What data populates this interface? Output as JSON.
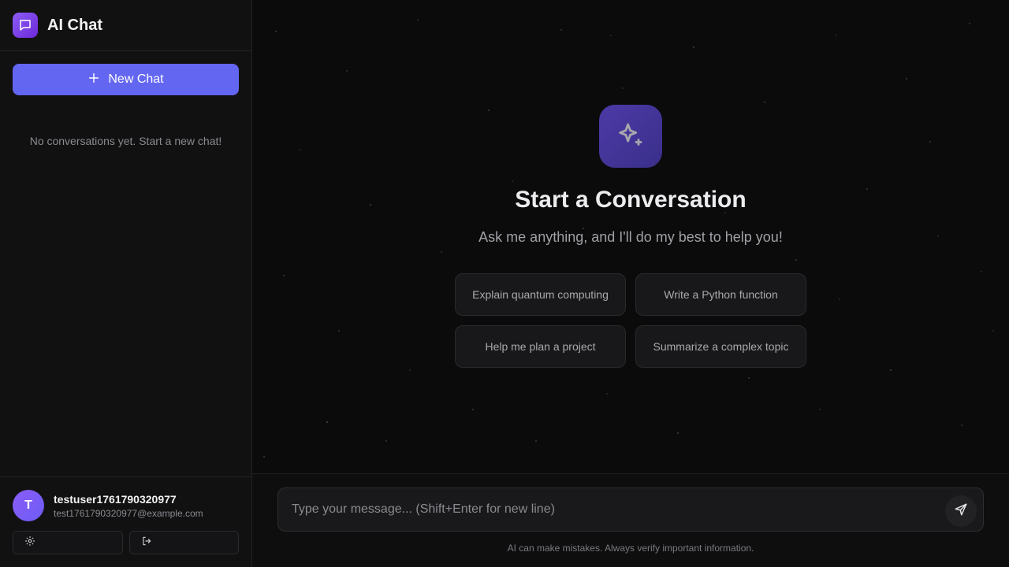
{
  "app": {
    "title": "AI Chat"
  },
  "sidebar": {
    "new_chat_label": "New Chat",
    "empty_text": "No conversations yet. Start a new chat!",
    "user": {
      "initial": "T",
      "name": "testuser1761790320977",
      "email": "test1761790320977@example.com"
    },
    "icons": [
      "chat-bubble-icon",
      "plus-icon",
      "gear-icon",
      "logout-icon"
    ]
  },
  "main": {
    "hero_title": "Start a Conversation",
    "hero_subtitle": "Ask me anything, and I'll do my best to help you!",
    "suggestions": [
      "Explain quantum computing",
      "Write a Python function",
      "Help me plan a project",
      "Summarize a complex topic"
    ],
    "composer": {
      "placeholder": "Type your message... (Shift+Enter for new line)"
    },
    "disclaimer": "AI can make mistakes. Always verify important information.",
    "icons": [
      "sparkles-icon",
      "send-icon"
    ]
  },
  "colors": {
    "accent": "#6366f1",
    "logo": "#8b5cf6",
    "background": "#0b0b0c",
    "sidebar": "#111112"
  }
}
